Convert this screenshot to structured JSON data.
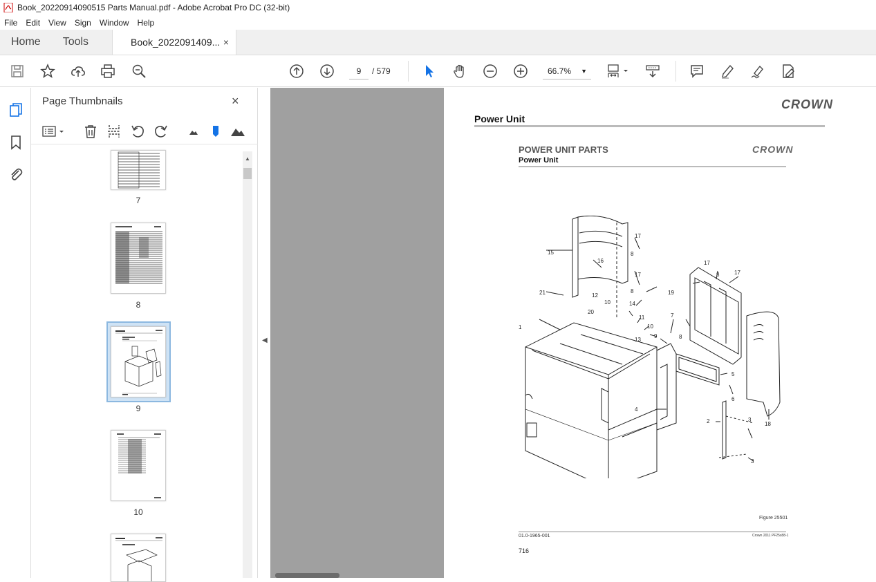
{
  "window": {
    "title": "Book_20220914090515 Parts Manual.pdf - Adobe Acrobat Pro DC (32-bit)"
  },
  "menu": [
    "File",
    "Edit",
    "View",
    "Sign",
    "Window",
    "Help"
  ],
  "tabs": {
    "home": "Home",
    "tools": "Tools",
    "document": "Book_2022091409...",
    "close": "×"
  },
  "toolbar": {
    "page_current": "9",
    "page_total": "/ 579",
    "zoom": "66.7%"
  },
  "thumbnails": {
    "title": "Page Thumbnails",
    "close": "×",
    "pages": [
      "7",
      "8",
      "9",
      "10"
    ],
    "selected": "9"
  },
  "document": {
    "header_title": "Power Unit",
    "logo": "CROWN",
    "section_title": "POWER UNIT PARTS",
    "section_subtitle": "Power Unit",
    "figure": "Figure 25501",
    "footer_left": "01.0-1965-001",
    "footer_right": "Crown 2011 PF25x88-1",
    "page_number": "716",
    "callouts": [
      "1",
      "2",
      "3",
      "3",
      "4",
      "5",
      "6",
      "7",
      "8",
      "8",
      "8",
      "8",
      "9",
      "10",
      "10",
      "11",
      "12",
      "13",
      "14",
      "15",
      "16",
      "17",
      "17",
      "17",
      "17",
      "18",
      "19",
      "20",
      "21"
    ]
  },
  "colors": {
    "accent": "#1473e6",
    "selection": "#cfe3f5",
    "docbg": "#a0a0a0"
  }
}
